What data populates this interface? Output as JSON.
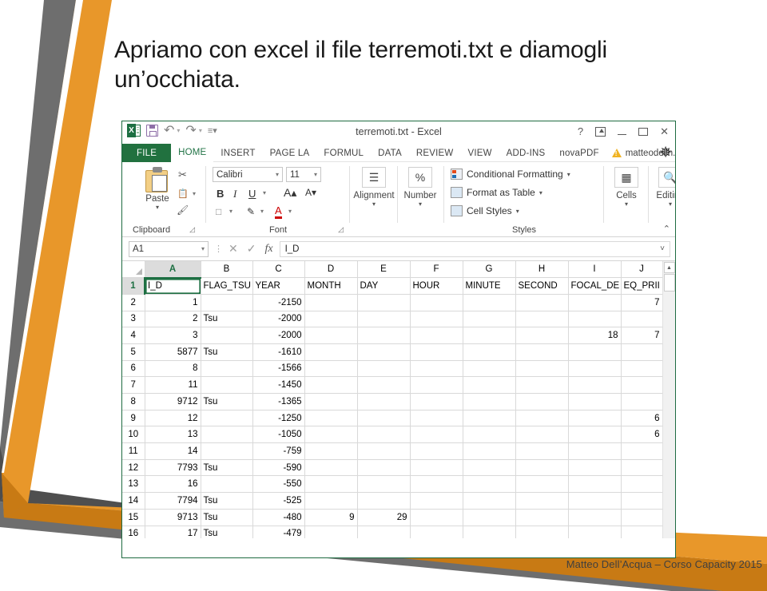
{
  "slide": {
    "title": "Apriamo con excel il file terremoti.txt e diamogli un’occhiata.",
    "footer": "Matteo Dell’Acqua – Corso Capacity 2015",
    "accent_orange": "#E8972A",
    "accent_grey": "#595959",
    "title_color": "#1A1A1A"
  },
  "excel": {
    "titlebar": {
      "document_title": "terremoti.txt - Excel",
      "quick_access": [
        "excel-app-icon",
        "save-icon",
        "undo-icon",
        "redo-icon",
        "customize-qat-icon"
      ],
      "window_buttons": [
        "help-?",
        "ribbon-display-options",
        "minimize",
        "restore-down",
        "close"
      ],
      "help_label": "?",
      "close_label": "✕"
    },
    "tabs": [
      {
        "label": "FILE",
        "state": "file"
      },
      {
        "label": "HOME",
        "state": "active"
      },
      {
        "label": "INSERT",
        "state": "normal"
      },
      {
        "label": "PAGE LA",
        "state": "normal"
      },
      {
        "label": "FORMUL",
        "state": "normal"
      },
      {
        "label": "DATA",
        "state": "normal"
      },
      {
        "label": "REVIEW",
        "state": "normal"
      },
      {
        "label": "VIEW",
        "state": "normal"
      },
      {
        "label": "ADD-INS",
        "state": "normal"
      },
      {
        "label": "novaPDF",
        "state": "normal"
      }
    ],
    "account": {
      "label": "matteodellh...",
      "warning_icon": "warning-triangle-icon",
      "caret": "▾"
    },
    "ribbon": {
      "groups": [
        {
          "name": "Clipboard",
          "label": "Clipboard"
        },
        {
          "name": "Font",
          "label": "Font"
        },
        {
          "name": "Alignment",
          "label": "Alignment"
        },
        {
          "name": "Number",
          "label": "Number"
        },
        {
          "name": "Styles",
          "label": "Styles"
        },
        {
          "name": "Cells",
          "label": "Cells"
        },
        {
          "name": "Editing",
          "label": "Editing"
        }
      ],
      "clipboard": {
        "paste_label": "Paste",
        "caret": "▾",
        "icons": [
          "cut-scissors-icon",
          "copy-icon",
          "format-painter-icon"
        ]
      },
      "font": {
        "family_value": "Calibri",
        "size_value": "11",
        "bold_label": "B",
        "italic_label": "I",
        "underline_label": "U",
        "grow_font_label": "A",
        "shrink_font_label": "A",
        "caret": "▾"
      },
      "alignment": {
        "label": "Alignment",
        "caret": "▾"
      },
      "number": {
        "label": "Number",
        "symbol": "%",
        "caret": "▾"
      },
      "styles": {
        "conditional_formatting": "Conditional Formatting",
        "format_as_table": "Format as Table",
        "cell_styles": "Cell Styles",
        "caret": "▾"
      },
      "cells": {
        "label": "Cells",
        "caret": "▾"
      },
      "editing": {
        "label": "Editing",
        "caret": "▾"
      },
      "collapse_ribbon": "⌃"
    },
    "formula_bar": {
      "name_box_value": "A1",
      "caret": "▾",
      "cancel_icon": "✕",
      "enter_icon": "✓",
      "fx_label": "fx",
      "formula_value": "I_D",
      "expand_caret": "˅"
    },
    "sheet": {
      "selected_cell": "A1",
      "column_letters": [
        "A",
        "B",
        "C",
        "D",
        "E",
        "F",
        "G",
        "H",
        "I",
        "J"
      ],
      "header_row": {
        "row_number": "1",
        "cells": [
          "I_D",
          "FLAG_TSU",
          "YEAR",
          "MONTH",
          "DAY",
          "HOUR",
          "MINUTE",
          "SECOND",
          "FOCAL_DE",
          "EQ_PRII"
        ]
      },
      "rows": [
        {
          "n": "2",
          "cells": [
            "1",
            "",
            "-2150",
            "",
            "",
            "",
            "",
            "",
            "",
            "7"
          ]
        },
        {
          "n": "3",
          "cells": [
            "2",
            "Tsu",
            "-2000",
            "",
            "",
            "",
            "",
            "",
            "",
            ""
          ]
        },
        {
          "n": "4",
          "cells": [
            "3",
            "",
            "-2000",
            "",
            "",
            "",
            "",
            "",
            "18",
            "7"
          ]
        },
        {
          "n": "5",
          "cells": [
            "5877",
            "Tsu",
            "-1610",
            "",
            "",
            "",
            "",
            "",
            "",
            ""
          ]
        },
        {
          "n": "6",
          "cells": [
            "8",
            "",
            "-1566",
            "",
            "",
            "",
            "",
            "",
            "",
            ""
          ]
        },
        {
          "n": "7",
          "cells": [
            "11",
            "",
            "-1450",
            "",
            "",
            "",
            "",
            "",
            "",
            ""
          ]
        },
        {
          "n": "8",
          "cells": [
            "9712",
            "Tsu",
            "-1365",
            "",
            "",
            "",
            "",
            "",
            "",
            ""
          ]
        },
        {
          "n": "9",
          "cells": [
            "12",
            "",
            "-1250",
            "",
            "",
            "",
            "",
            "",
            "",
            "6"
          ]
        },
        {
          "n": "10",
          "cells": [
            "13",
            "",
            "-1050",
            "",
            "",
            "",
            "",
            "",
            "",
            "6"
          ]
        },
        {
          "n": "11",
          "cells": [
            "14",
            "",
            "-759",
            "",
            "",
            "",
            "",
            "",
            "",
            ""
          ]
        },
        {
          "n": "12",
          "cells": [
            "7793",
            "Tsu",
            "-590",
            "",
            "",
            "",
            "",
            "",
            "",
            ""
          ]
        },
        {
          "n": "13",
          "cells": [
            "16",
            "",
            "-550",
            "",
            "",
            "",
            "",
            "",
            "",
            ""
          ]
        },
        {
          "n": "14",
          "cells": [
            "7794",
            "Tsu",
            "-525",
            "",
            "",
            "",
            "",
            "",
            "",
            ""
          ]
        },
        {
          "n": "15",
          "cells": [
            "9713",
            "Tsu",
            "-480",
            "9",
            "29",
            "",
            "",
            "",
            "",
            ""
          ]
        },
        {
          "n": "16",
          "cells": [
            "17",
            "Tsu",
            "-479",
            "",
            "",
            "",
            "",
            "",
            "",
            ""
          ]
        }
      ],
      "scrollbar": {
        "up_arrow": "▲"
      }
    }
  }
}
